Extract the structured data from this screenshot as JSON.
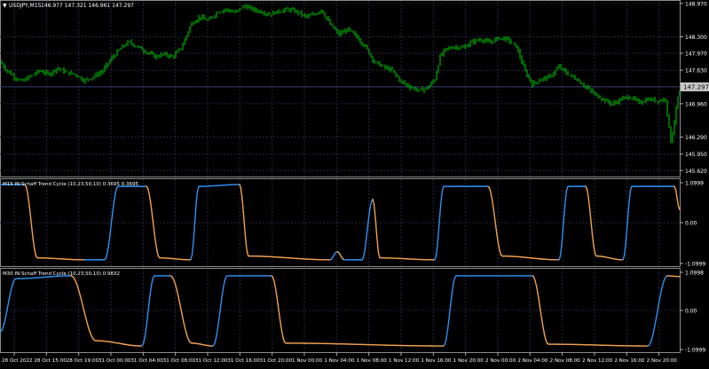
{
  "window": {
    "symbol_label": "USDJPY,M15",
    "ohlc_label": "146.977 147.321 146.961 147.297"
  },
  "colors": {
    "background": "#000000",
    "grid": "#262646",
    "separator": "#9a9a9a",
    "axis_text": "#ffffff",
    "candles": "#00d000",
    "stc_up": "#2f8ff0",
    "stc_down": "#f0a050",
    "level_line": "#3a3a78",
    "bid_badge": "#c8c8c8"
  },
  "main_chart": {
    "price_ticks": [
      "148.970",
      "148.300",
      "147.970",
      "147.630",
      "146.960",
      "146.290",
      "145.950",
      "145.620"
    ],
    "current_price": "147.297",
    "current_price_value": 147.297,
    "ylim": [
      145.5,
      149.02
    ]
  },
  "indicator1": {
    "label": "M15 IN Schaff Trend Cycle (10,23,50,10) 0.3695 0.3695",
    "ticks": [
      "1.0999",
      "0.00",
      "-1.0999"
    ]
  },
  "indicator2": {
    "label": "M30 IN Schaff Trend Cycle (10,23,50,10) 0.9832",
    "ticks": [
      "1.0998",
      "0.00",
      "-1.0999"
    ]
  },
  "time_axis": {
    "labels": [
      "28 Oct 2022",
      "28 Oct 15:00",
      "28 Oct 19:00",
      "31 Oct 00:00",
      "31 Oct 04:00",
      "31 Oct 08:00",
      "31 Oct 12:00",
      "31 Oct 16:00",
      "31 Oct 20:00",
      "1 Nov 00:00",
      "1 Nov 04:00",
      "1 Nov 08:00",
      "1 Nov 12:00",
      "1 Nov 16:00",
      "1 Nov 20:00",
      "2 Nov 00:00",
      "2 Nov 04:00",
      "2 Nov 08:00",
      "2 Nov 12:00",
      "2 Nov 16:00",
      "2 Nov 20:00"
    ]
  },
  "chart_data": [
    {
      "type": "candlestick",
      "series": [
        {
          "name": "USDJPY,M15",
          "close_path": [
            [
              0,
              147.8
            ],
            [
              8,
              147.62
            ],
            [
              16,
              147.5
            ],
            [
              25,
              147.4
            ],
            [
              35,
              147.52
            ],
            [
              45,
              147.62
            ],
            [
              55,
              147.55
            ],
            [
              65,
              147.68
            ],
            [
              75,
              147.58
            ],
            [
              85,
              147.55
            ],
            [
              95,
              147.42
            ],
            [
              105,
              147.5
            ],
            [
              115,
              147.6
            ],
            [
              125,
              147.85
            ],
            [
              135,
              148.05
            ],
            [
              145,
              148.2
            ],
            [
              155,
              148.1
            ],
            [
              165,
              148.0
            ],
            [
              175,
              147.9
            ],
            [
              185,
              147.95
            ],
            [
              195,
              147.9
            ],
            [
              205,
              148.1
            ],
            [
              215,
              148.55
            ],
            [
              225,
              148.7
            ],
            [
              235,
              148.62
            ],
            [
              245,
              148.8
            ],
            [
              255,
              148.85
            ],
            [
              265,
              148.78
            ],
            [
              275,
              148.92
            ],
            [
              285,
              148.85
            ],
            [
              295,
              148.8
            ],
            [
              305,
              148.75
            ],
            [
              315,
              148.82
            ],
            [
              325,
              148.85
            ],
            [
              335,
              148.8
            ],
            [
              345,
              148.7
            ],
            [
              355,
              148.75
            ],
            [
              362,
              148.85
            ],
            [
              372,
              148.55
            ],
            [
              382,
              148.35
            ],
            [
              392,
              148.45
            ],
            [
              402,
              148.3
            ],
            [
              412,
              148.1
            ],
            [
              422,
              147.8
            ],
            [
              432,
              147.7
            ],
            [
              442,
              147.62
            ],
            [
              452,
              147.4
            ],
            [
              462,
              147.3
            ],
            [
              472,
              147.22
            ],
            [
              482,
              147.28
            ],
            [
              490,
              147.45
            ],
            [
              496,
              147.9
            ],
            [
              502,
              148.05
            ],
            [
              512,
              148.1
            ],
            [
              522,
              148.08
            ],
            [
              532,
              148.2
            ],
            [
              542,
              148.25
            ],
            [
              552,
              148.18
            ],
            [
              562,
              148.28
            ],
            [
              572,
              148.25
            ],
            [
              582,
              148.1
            ],
            [
              592,
              147.6
            ],
            [
              600,
              147.35
            ],
            [
              610,
              147.45
            ],
            [
              620,
              147.5
            ],
            [
              630,
              147.7
            ],
            [
              640,
              147.55
            ],
            [
              650,
              147.45
            ],
            [
              660,
              147.3
            ],
            [
              670,
              147.15
            ],
            [
              680,
              147.05
            ],
            [
              690,
              146.95
            ],
            [
              700,
              147.05
            ],
            [
              710,
              147.1
            ],
            [
              720,
              146.98
            ],
            [
              730,
              147.05
            ],
            [
              740,
              147.02
            ],
            [
              750,
              147.05
            ],
            [
              756,
              146.2
            ],
            [
              760,
              146.6
            ],
            [
              764,
              147.1
            ],
            [
              768,
              147.3
            ]
          ]
        }
      ]
    },
    {
      "type": "line",
      "title": "M15 IN Schaff Trend Cycle (10,23,50,10)",
      "ylim": [
        -1.0999,
        1.0999
      ],
      "series": [
        {
          "name": "STC M15",
          "points": [
            [
              0,
              1.05
            ],
            [
              28,
              1.05
            ],
            [
              42,
              -0.95
            ],
            [
              95,
              -1.0
            ],
            [
              118,
              -1.0
            ],
            [
              133,
              1.0
            ],
            [
              165,
              1.0
            ],
            [
              180,
              -0.95
            ],
            [
              215,
              -1.0
            ],
            [
              224,
              1.0
            ],
            [
              270,
              1.05
            ],
            [
              280,
              -0.9
            ],
            [
              372,
              -1.0
            ],
            [
              380,
              -0.78
            ],
            [
              388,
              -1.0
            ],
            [
              408,
              -1.0
            ],
            [
              420,
              0.65
            ],
            [
              428,
              -0.95
            ],
            [
              490,
              -1.0
            ],
            [
              500,
              1.0
            ],
            [
              550,
              1.0
            ],
            [
              566,
              -0.9
            ],
            [
              630,
              -1.0
            ],
            [
              640,
              1.0
            ],
            [
              660,
              1.0
            ],
            [
              672,
              -0.9
            ],
            [
              702,
              -1.0
            ],
            [
              712,
              1.0
            ],
            [
              760,
              1.0
            ],
            [
              766,
              0.37
            ]
          ]
        }
      ]
    },
    {
      "type": "line",
      "title": "M30 IN Schaff Trend Cycle (10,23,50,10)",
      "ylim": [
        -1.0999,
        1.0998
      ],
      "series": [
        {
          "name": "STC M30",
          "points": [
            [
              0,
              -0.6
            ],
            [
              18,
              0.92
            ],
            [
              80,
              1.0
            ],
            [
              108,
              -0.85
            ],
            [
              160,
              -1.0
            ],
            [
              174,
              1.0
            ],
            [
              192,
              1.0
            ],
            [
              216,
              -0.92
            ],
            [
              240,
              -1.0
            ],
            [
              256,
              1.0
            ],
            [
              306,
              1.0
            ],
            [
              322,
              -0.92
            ],
            [
              500,
              -1.0
            ],
            [
              514,
              1.0
            ],
            [
              600,
              1.0
            ],
            [
              618,
              -0.95
            ],
            [
              730,
              -1.0
            ],
            [
              752,
              1.0
            ],
            [
              766,
              0.98
            ]
          ]
        }
      ]
    }
  ]
}
